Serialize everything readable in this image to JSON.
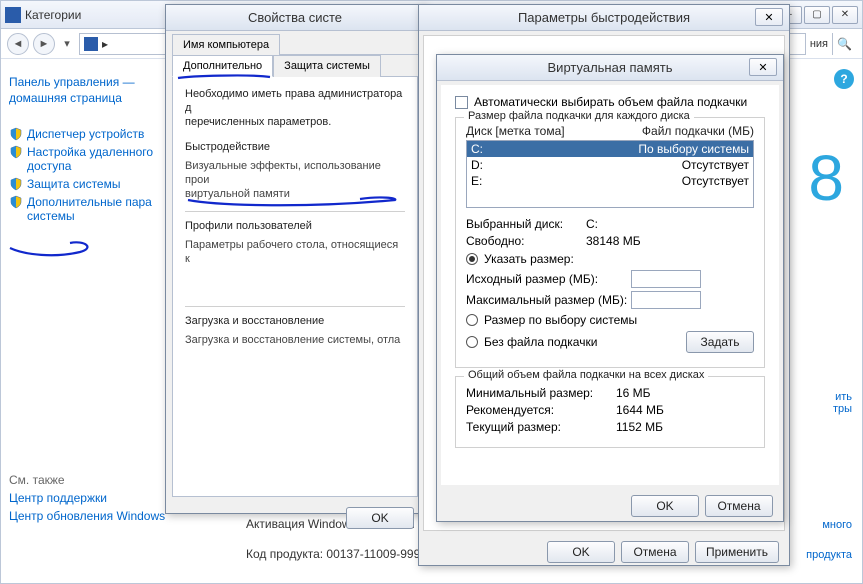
{
  "explorer": {
    "title": "Категории",
    "path_hint": "ния",
    "links": {
      "home1": "Панель управления —",
      "home2": "домашняя страница",
      "devmgr": "Диспетчер устройств",
      "remote1": "Настройка удаленного",
      "remote2": "доступа",
      "protect": "Защита системы",
      "adv1": "Дополнительные пара",
      "adv2": "системы"
    },
    "see_also": "См. также",
    "support": "Центр поддержки",
    "update": "Центр обновления Windows",
    "activation": "Активация Windows выполнен",
    "product": "Код продукта: 00137-11009-999",
    "more": "много",
    "product_link": "продукта",
    "right_links": "ить\nтры"
  },
  "sysprop": {
    "title": "Свойства систе",
    "tabs": {
      "name": "Имя компьютера",
      "adv": "Дополнительно",
      "protect": "Защита системы"
    },
    "need_admin": "Необходимо иметь права администратора д\nперечисленных параметров.",
    "perf_h": "Быстродействие",
    "perf_d": "Визуальные эффекты, использование прои\nвиртуальной памяти",
    "prof_h": "Профили пользователей",
    "prof_d": "Параметры рабочего стола, относящиеся к",
    "boot_h": "Загрузка и восстановление",
    "boot_d": "Загрузка и восстановление системы, отла",
    "ok": "OK"
  },
  "perf": {
    "title": "Параметры быстродействия",
    "ok": "OK",
    "cancel": "Отмена",
    "apply": "Применить"
  },
  "vmem": {
    "title": "Виртуальная память",
    "auto": "Автоматически выбирать объем файла подкачки",
    "grp1": "Размер файла подкачки для каждого диска",
    "col1": "Диск [метка тома]",
    "col2": "Файл подкачки (МБ)",
    "disks": [
      {
        "d": "C:",
        "v": "По выбору системы",
        "sel": true
      },
      {
        "d": "D:",
        "v": "Отсутствует"
      },
      {
        "d": "E:",
        "v": "Отсутствует"
      }
    ],
    "sel_disk_l": "Выбранный диск:",
    "sel_disk_v": "C:",
    "free_l": "Свободно:",
    "free_v": "38148 МБ",
    "r_custom": "Указать размер:",
    "init_l": "Исходный размер (МБ):",
    "max_l": "Максимальный размер (МБ):",
    "r_sys": "Размер по выбору системы",
    "r_none": "Без файла подкачки",
    "set": "Задать",
    "grp2": "Общий объем файла подкачки на всех дисках",
    "min_l": "Минимальный размер:",
    "min_v": "16 МБ",
    "rec_l": "Рекомендуется:",
    "rec_v": "1644 МБ",
    "cur_l": "Текущий размер:",
    "cur_v": "1152 МБ",
    "ok": "OK",
    "cancel": "Отмена"
  }
}
